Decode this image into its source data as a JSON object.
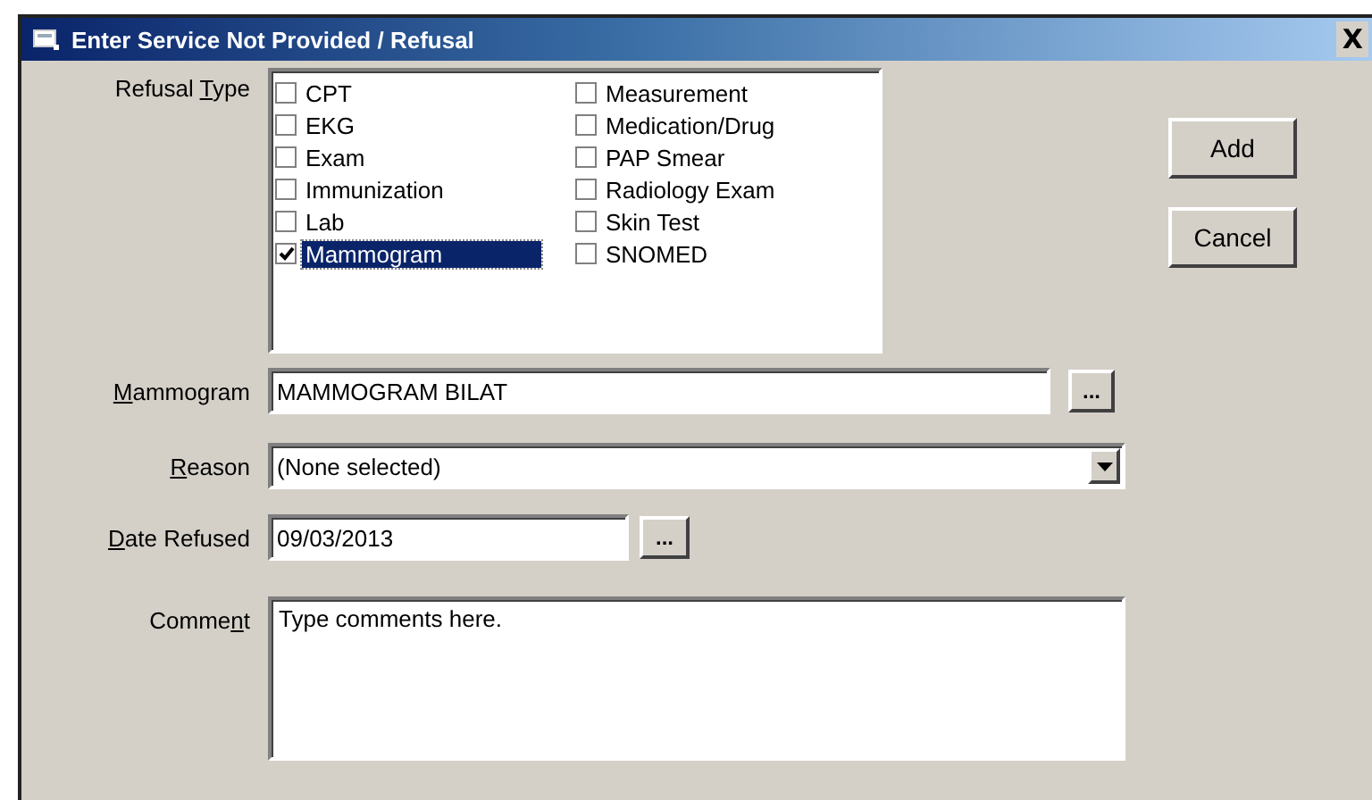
{
  "window": {
    "title": "Enter Service Not Provided / Refusal",
    "close": "X"
  },
  "refusal_type": {
    "label": {
      "before": "Refusal ",
      "access_key": "T",
      "after": "ype"
    },
    "items": [
      {
        "label": "CPT",
        "checked": false,
        "selected": false
      },
      {
        "label": "EKG",
        "checked": false,
        "selected": false
      },
      {
        "label": "Exam",
        "checked": false,
        "selected": false
      },
      {
        "label": "Immunization",
        "checked": false,
        "selected": false
      },
      {
        "label": "Lab",
        "checked": false,
        "selected": false
      },
      {
        "label": "Mammogram",
        "checked": true,
        "selected": true
      },
      {
        "label": "Measurement",
        "checked": false,
        "selected": false
      },
      {
        "label": "Medication/Drug",
        "checked": false,
        "selected": false
      },
      {
        "label": "PAP Smear",
        "checked": false,
        "selected": false
      },
      {
        "label": "Radiology Exam",
        "checked": false,
        "selected": false
      },
      {
        "label": "Skin Test",
        "checked": false,
        "selected": false
      },
      {
        "label": "SNOMED",
        "checked": false,
        "selected": false
      }
    ]
  },
  "buttons": [
    "Add",
    "Cancel"
  ],
  "fields": [
    {
      "kind": "lookup",
      "label": {
        "access_key": "M",
        "after": "ammogram"
      },
      "value": "MAMMOGRAM BILAT",
      "button": "..."
    },
    {
      "kind": "combo",
      "label": {
        "access_key": "R",
        "after": "eason"
      },
      "value": "(None selected)"
    },
    {
      "kind": "date",
      "label": {
        "access_key": "D",
        "after": "ate Refused"
      },
      "value": "09/03/2013",
      "button": "..."
    },
    {
      "kind": "memo",
      "label": {
        "before": "Comme",
        "access_key": "n",
        "after": "t"
      },
      "value": "Type comments here."
    }
  ]
}
